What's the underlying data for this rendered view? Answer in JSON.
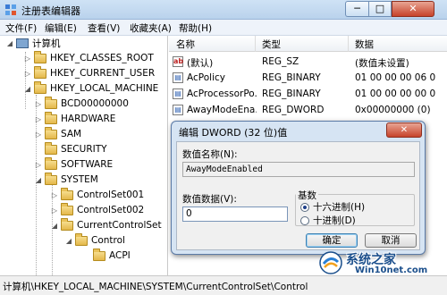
{
  "window": {
    "title": "注册表编辑器",
    "minimize": "─",
    "maximize": "□",
    "close": "✕"
  },
  "menu": [
    "文件(F)",
    "编辑(E)",
    "查看(V)",
    "收藏夹(A)",
    "帮助(H)"
  ],
  "tree": {
    "root": "计算机",
    "items": [
      "HKEY_CLASSES_ROOT",
      "HKEY_CURRENT_USER",
      "HKEY_LOCAL_MACHINE",
      "BCD00000000",
      "HARDWARE",
      "SAM",
      "SECURITY",
      "SOFTWARE",
      "SYSTEM",
      "ControlSet001",
      "ControlSet002",
      "CurrentControlSet",
      "Control",
      "ACPI"
    ]
  },
  "list": {
    "columns": [
      "名称",
      "类型",
      "数据"
    ],
    "rows": [
      {
        "icon": "ab",
        "name": "(默认)",
        "type": "REG_SZ",
        "data": "(数值未设置)"
      },
      {
        "icon": "bin",
        "name": "AcPolicy",
        "type": "REG_BINARY",
        "data": "01 00 00 00 06 0"
      },
      {
        "icon": "bin",
        "name": "AcProcessorPo...",
        "type": "REG_BINARY",
        "data": "01 00 00 00 00 0"
      },
      {
        "icon": "bin",
        "name": "AwayModeEna...",
        "type": "REG_DWORD",
        "data": "0x00000000 (0)"
      }
    ]
  },
  "dialog": {
    "title": "编辑 DWORD (32 位)值",
    "close": "✕",
    "name_label": "数值名称(N):",
    "name_value": "AwayModeEnabled",
    "data_label": "数值数据(V):",
    "data_value": "0",
    "base_label": "基数",
    "radio_hex": "十六进制(H)",
    "radio_dec": "十进制(D)",
    "ok": "确定",
    "cancel": "取消"
  },
  "status": "计算机\\HKEY_LOCAL_MACHINE\\SYSTEM\\CurrentControlSet\\Control",
  "watermark": {
    "line1": "系统之家",
    "line2": "Win10net.com"
  }
}
